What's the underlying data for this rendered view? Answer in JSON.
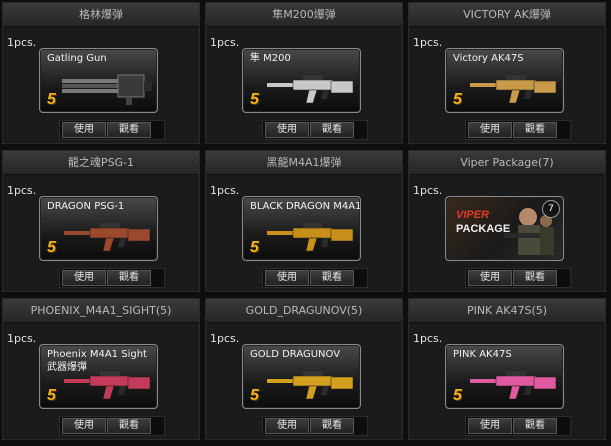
{
  "items": [
    {
      "title": "格林爆弹",
      "qty": "1pcs.",
      "card_name": "Gatling Gun",
      "card_sub": "",
      "grade": "5",
      "icon": "gatling-gun-icon",
      "color": "#7a7a7a",
      "buttons": {
        "use": "使用",
        "view": "觀看"
      }
    },
    {
      "title": "隼M200爆弹",
      "qty": "1pcs.",
      "card_name": "隼 M200",
      "card_sub": "",
      "grade": "5",
      "icon": "sniper-rifle-icon",
      "color": "#c8c8c8",
      "buttons": {
        "use": "使用",
        "view": "觀看"
      }
    },
    {
      "title": "VICTORY AK爆弹",
      "qty": "1pcs.",
      "card_name": "Victory AK47S",
      "card_sub": "",
      "grade": "5",
      "icon": "ak47-icon",
      "color": "#c89a4a",
      "buttons": {
        "use": "使用",
        "view": "觀看"
      }
    },
    {
      "title": "龍之魂PSG-1",
      "qty": "1pcs.",
      "card_name": "DRAGON PSG-1",
      "card_sub": "",
      "grade": "5",
      "icon": "psg1-icon",
      "color": "#9a4a2a",
      "buttons": {
        "use": "使用",
        "view": "觀看"
      }
    },
    {
      "title": "黑龍M4A1爆弹",
      "qty": "1pcs.",
      "card_name": "BLACK DRAGON M4A1",
      "card_sub": "",
      "grade": "5",
      "icon": "m4a1-icon",
      "color": "#c8901a",
      "buttons": {
        "use": "使用",
        "view": "觀看"
      }
    },
    {
      "title": "Viper Package(7)",
      "qty": "1pcs.",
      "card_name": "",
      "card_sub": "",
      "grade": "",
      "icon": "viper-package-icon",
      "color": "#e53a2a",
      "viper": {
        "line1": "VIPER",
        "line2": "PACKAGE",
        "count": "7"
      },
      "buttons": {
        "use": "使用",
        "view": "觀看"
      }
    },
    {
      "title": "PHOENIX_M4A1_SIGHT(5)",
      "qty": "1pcs.",
      "card_name": "Phoenix M4A1 Sight",
      "card_sub": "武器爆彈",
      "grade": "5",
      "icon": "m4a1-sight-icon",
      "color": "#c43a5a",
      "buttons": {
        "use": "使用",
        "view": "觀看"
      }
    },
    {
      "title": "GOLD_DRAGUNOV(5)",
      "qty": "1pcs.",
      "card_name": "GOLD DRAGUNOV",
      "card_sub": "",
      "grade": "5",
      "icon": "dragunov-icon",
      "color": "#d4a020",
      "buttons": {
        "use": "使用",
        "view": "觀看"
      }
    },
    {
      "title": "PINK AK47S(5)",
      "qty": "1pcs.",
      "card_name": "PINK AK47S",
      "card_sub": "",
      "grade": "5",
      "icon": "pink-ak47-icon",
      "color": "#e05aa0",
      "buttons": {
        "use": "使用",
        "view": "觀看"
      }
    }
  ]
}
